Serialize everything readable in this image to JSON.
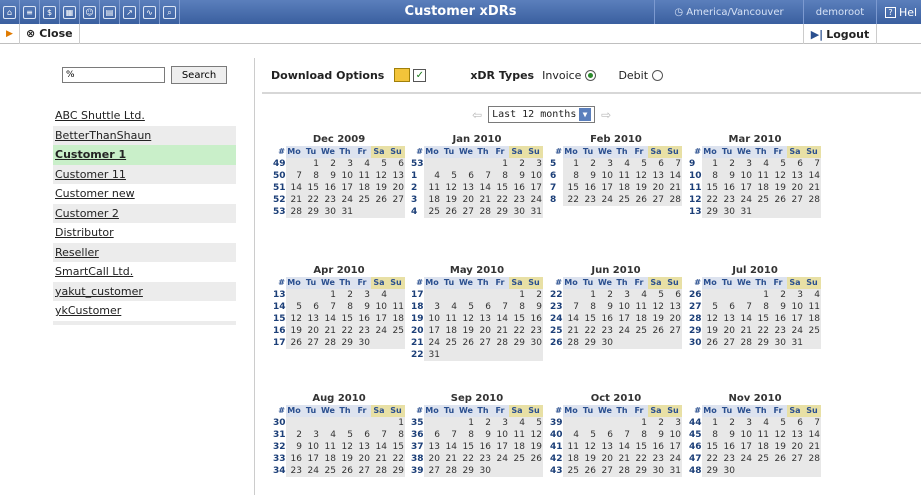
{
  "topbar": {
    "title": "Customer xDRs",
    "timezone": "America/Vancouver",
    "user": "demoroot",
    "help": "Hel"
  },
  "toolbar": {
    "close_label": "Close",
    "logout_label": "Logout"
  },
  "search": {
    "value": "%",
    "button_label": "Search"
  },
  "customers": [
    {
      "label": "ABC Shuttle Ltd.",
      "selected": false
    },
    {
      "label": "BetterThanShaun",
      "selected": false
    },
    {
      "label": "Customer 1",
      "selected": true
    },
    {
      "label": "Customer 11",
      "selected": false
    },
    {
      "label": "Customer new",
      "selected": false
    },
    {
      "label": "Customer 2",
      "selected": false
    },
    {
      "label": "Distributor",
      "selected": false
    },
    {
      "label": "Reseller",
      "selected": false
    },
    {
      "label": "SmartCall Ltd.",
      "selected": false
    },
    {
      "label": "yakut_customer",
      "selected": false
    },
    {
      "label": "ykCustomer",
      "selected": false
    }
  ],
  "options": {
    "download_label": "Download Options",
    "xdr_types_label": "xDR Types",
    "invoice_label": "Invoice",
    "debit_label": "Debit",
    "invoice_selected": true
  },
  "period": {
    "selected": "Last 12 months"
  },
  "calendar_header": [
    "#",
    "Mo",
    "Tu",
    "We",
    "Th",
    "Fr",
    "Sa",
    "Su"
  ],
  "months": [
    {
      "title": "Dec 2009",
      "weeks": [
        [
          49,
          "",
          "1",
          "2",
          "3",
          "4",
          "5",
          "6"
        ],
        [
          50,
          "7",
          "8",
          "9",
          "10",
          "11",
          "12",
          "13"
        ],
        [
          51,
          "14",
          "15",
          "16",
          "17",
          "18",
          "19",
          "20"
        ],
        [
          52,
          "21",
          "22",
          "23",
          "24",
          "25",
          "26",
          "27"
        ],
        [
          53,
          "28",
          "29",
          "30",
          "31",
          "",
          "",
          ""
        ]
      ]
    },
    {
      "title": "Jan 2010",
      "weeks": [
        [
          53,
          "",
          "",
          "",
          "",
          "1",
          "2",
          "3"
        ],
        [
          1,
          "4",
          "5",
          "6",
          "7",
          "8",
          "9",
          "10"
        ],
        [
          2,
          "11",
          "12",
          "13",
          "14",
          "15",
          "16",
          "17"
        ],
        [
          3,
          "18",
          "19",
          "20",
          "21",
          "22",
          "23",
          "24"
        ],
        [
          4,
          "25",
          "26",
          "27",
          "28",
          "29",
          "30",
          "31"
        ]
      ]
    },
    {
      "title": "Feb 2010",
      "weeks": [
        [
          5,
          "1",
          "2",
          "3",
          "4",
          "5",
          "6",
          "7"
        ],
        [
          6,
          "8",
          "9",
          "10",
          "11",
          "12",
          "13",
          "14"
        ],
        [
          7,
          "15",
          "16",
          "17",
          "18",
          "19",
          "20",
          "21"
        ],
        [
          8,
          "22",
          "23",
          "24",
          "25",
          "26",
          "27",
          "28"
        ]
      ]
    },
    {
      "title": "Mar 2010",
      "weeks": [
        [
          9,
          "1",
          "2",
          "3",
          "4",
          "5",
          "6",
          "7"
        ],
        [
          10,
          "8",
          "9",
          "10",
          "11",
          "12",
          "13",
          "14"
        ],
        [
          11,
          "15",
          "16",
          "17",
          "18",
          "19",
          "20",
          "21"
        ],
        [
          12,
          "22",
          "23",
          "24",
          "25",
          "26",
          "27",
          "28"
        ],
        [
          13,
          "29",
          "30",
          "31",
          "",
          "",
          "",
          ""
        ]
      ]
    },
    {
      "title": "Apr 2010",
      "weeks": [
        [
          13,
          "",
          "",
          "1",
          "2",
          "3",
          "4",
          ""
        ],
        [
          14,
          "5",
          "6",
          "7",
          "8",
          "9",
          "10",
          "11"
        ],
        [
          15,
          "12",
          "13",
          "14",
          "15",
          "16",
          "17",
          "18"
        ],
        [
          16,
          "19",
          "20",
          "21",
          "22",
          "23",
          "24",
          "25"
        ],
        [
          17,
          "26",
          "27",
          "28",
          "29",
          "30",
          "",
          ""
        ]
      ]
    },
    {
      "title": "May 2010",
      "weeks": [
        [
          17,
          "",
          "",
          "",
          "",
          "",
          "1",
          "2"
        ],
        [
          18,
          "3",
          "4",
          "5",
          "6",
          "7",
          "8",
          "9"
        ],
        [
          19,
          "10",
          "11",
          "12",
          "13",
          "14",
          "15",
          "16"
        ],
        [
          20,
          "17",
          "18",
          "19",
          "20",
          "21",
          "22",
          "23"
        ],
        [
          21,
          "24",
          "25",
          "26",
          "27",
          "28",
          "29",
          "30"
        ],
        [
          22,
          "31",
          "",
          "",
          "",
          "",
          "",
          ""
        ]
      ]
    },
    {
      "title": "Jun 2010",
      "weeks": [
        [
          22,
          "",
          "1",
          "2",
          "3",
          "4",
          "5",
          "6"
        ],
        [
          23,
          "7",
          "8",
          "9",
          "10",
          "11",
          "12",
          "13"
        ],
        [
          24,
          "14",
          "15",
          "16",
          "17",
          "18",
          "19",
          "20"
        ],
        [
          25,
          "21",
          "22",
          "23",
          "24",
          "25",
          "26",
          "27"
        ],
        [
          26,
          "28",
          "29",
          "30",
          "",
          "",
          "",
          ""
        ]
      ]
    },
    {
      "title": "Jul 2010",
      "weeks": [
        [
          26,
          "",
          "",
          "",
          "1",
          "2",
          "3",
          "4"
        ],
        [
          27,
          "5",
          "6",
          "7",
          "8",
          "9",
          "10",
          "11"
        ],
        [
          28,
          "12",
          "13",
          "14",
          "15",
          "16",
          "17",
          "18"
        ],
        [
          29,
          "19",
          "20",
          "21",
          "22",
          "23",
          "24",
          "25"
        ],
        [
          30,
          "26",
          "27",
          "28",
          "29",
          "30",
          "31",
          ""
        ]
      ]
    },
    {
      "title": "Aug 2010",
      "weeks": [
        [
          30,
          "",
          "",
          "",
          "",
          "",
          "",
          "1"
        ],
        [
          31,
          "2",
          "3",
          "4",
          "5",
          "6",
          "7",
          "8"
        ],
        [
          32,
          "9",
          "10",
          "11",
          "12",
          "13",
          "14",
          "15"
        ],
        [
          33,
          "16",
          "17",
          "18",
          "19",
          "20",
          "21",
          "22"
        ],
        [
          34,
          "23",
          "24",
          "25",
          "26",
          "27",
          "28",
          "29"
        ]
      ]
    },
    {
      "title": "Sep 2010",
      "weeks": [
        [
          35,
          "",
          "",
          "1",
          "2",
          "3",
          "4",
          "5"
        ],
        [
          36,
          "6",
          "7",
          "8",
          "9",
          "10",
          "11",
          "12"
        ],
        [
          37,
          "13",
          "14",
          "15",
          "16",
          "17",
          "18",
          "19"
        ],
        [
          38,
          "20",
          "21",
          "22",
          "23",
          "24",
          "25",
          "26"
        ],
        [
          39,
          "27",
          "28",
          "29",
          "30",
          "",
          "",
          ""
        ]
      ]
    },
    {
      "title": "Oct 2010",
      "weeks": [
        [
          39,
          "",
          "",
          "",
          "",
          "1",
          "2",
          "3"
        ],
        [
          40,
          "4",
          "5",
          "6",
          "7",
          "8",
          "9",
          "10"
        ],
        [
          41,
          "11",
          "12",
          "13",
          "14",
          "15",
          "16",
          "17"
        ],
        [
          42,
          "18",
          "19",
          "20",
          "21",
          "22",
          "23",
          "24"
        ],
        [
          43,
          "25",
          "26",
          "27",
          "28",
          "29",
          "30",
          "31"
        ]
      ]
    },
    {
      "title": "Nov 2010",
      "weeks": [
        [
          44,
          "1",
          "2",
          "3",
          "4",
          "5",
          "6",
          "7"
        ],
        [
          45,
          "8",
          "9",
          "10",
          "11",
          "12",
          "13",
          "14"
        ],
        [
          46,
          "15",
          "16",
          "17",
          "18",
          "19",
          "20",
          "21"
        ],
        [
          47,
          "22",
          "23",
          "24",
          "25",
          "26",
          "27",
          "28"
        ],
        [
          48,
          "29",
          "30",
          "",
          "",
          "",
          "",
          ""
        ]
      ]
    }
  ]
}
